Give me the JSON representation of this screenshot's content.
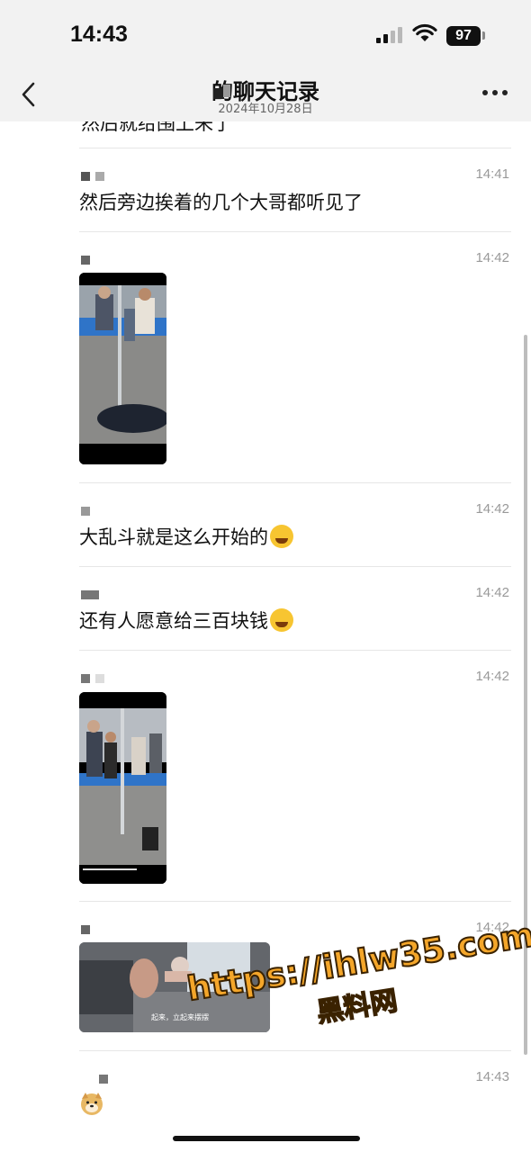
{
  "status_bar": {
    "time": "14:43",
    "battery": "97"
  },
  "header": {
    "title": "的聊天记录",
    "subtitle": "2024年10月28日"
  },
  "chat": {
    "partial_text": "然后就给围上来了",
    "messages": [
      {
        "timestamp": "14:41",
        "text": "然后旁边挨着的几个大哥都听见了"
      },
      {
        "timestamp": "14:42",
        "image": "video-thumbnail"
      },
      {
        "timestamp": "14:42",
        "text": "大乱斗就是这么开始的",
        "emoji": "crying-laughing-emoji"
      },
      {
        "timestamp": "14:42",
        "text": "还有人愿意给三百块钱",
        "emoji": "crying-laughing-emoji"
      },
      {
        "timestamp": "14:42",
        "image": "video-thumbnail"
      },
      {
        "timestamp": "14:42",
        "image": "video-thumbnail",
        "caption": "起来，立起来摆摆"
      },
      {
        "timestamp": "14:43",
        "emoji": "doge-emoji"
      }
    ]
  },
  "watermark": {
    "url": "https://ihlw35.com",
    "name": "黑料网"
  },
  "colors": {
    "timestamp": "#999999",
    "divider": "#e6e6e6",
    "header_bg": "#f2f2f2",
    "watermark": "#f4a62a"
  }
}
